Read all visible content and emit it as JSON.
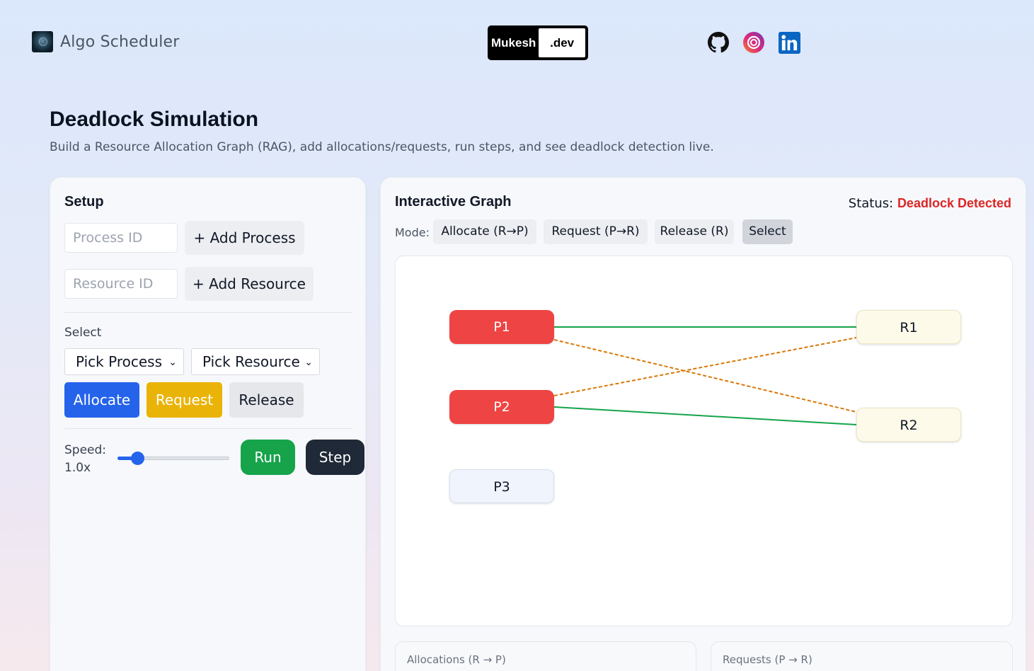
{
  "header": {
    "app_name": "Algo Scheduler",
    "brand_left": "Mukesh",
    "brand_right": ".dev",
    "social": [
      "github-icon",
      "instagram-icon",
      "linkedin-icon"
    ]
  },
  "page": {
    "title": "Deadlock Simulation",
    "subtitle": "Build a Resource Allocation Graph (RAG), add allocations/requests, run steps, and see deadlock detection live."
  },
  "setup": {
    "title": "Setup",
    "process_placeholder": "Process ID",
    "add_process_label": "+ Add Process",
    "resource_placeholder": "Resource ID",
    "add_resource_label": "+ Add Resource",
    "select_label": "Select",
    "pick_process": "Pick Process",
    "pick_resource": "Pick Resource",
    "allocate_label": "Allocate",
    "request_label": "Request",
    "release_label": "Release",
    "speed_label": "Speed:",
    "speed_value": "1.0x",
    "speed_fraction": 0.18,
    "run_label": "Run",
    "step_label": "Step",
    "ghost_text": "R"
  },
  "graph": {
    "title": "Interactive Graph",
    "status_label": "Status:",
    "status_value": "Deadlock Detected",
    "mode_label": "Mode:",
    "modes": [
      {
        "label": "Allocate (R→P)",
        "active": false
      },
      {
        "label": "Request (P→R)",
        "active": false
      },
      {
        "label": "Release (R)",
        "active": false
      },
      {
        "label": "Select",
        "active": true
      }
    ],
    "processes": [
      {
        "id": "P1",
        "deadlocked": true
      },
      {
        "id": "P2",
        "deadlocked": true
      },
      {
        "id": "P3",
        "deadlocked": false
      }
    ],
    "resources": [
      {
        "id": "R1"
      },
      {
        "id": "R2"
      }
    ],
    "allocations": [
      {
        "from": "R1",
        "to": "P1"
      },
      {
        "from": "R2",
        "to": "P2"
      }
    ],
    "requests": [
      {
        "from": "P1",
        "to": "R2"
      },
      {
        "from": "P2",
        "to": "R1"
      }
    ],
    "colors": {
      "allocation": "#16a34a",
      "request": "#d97706",
      "deadlocked": "#ef4444",
      "status": "#dc2626"
    }
  },
  "panels": {
    "allocations_title": "Allocations (R → P)",
    "requests_title": "Requests (P → R)"
  }
}
